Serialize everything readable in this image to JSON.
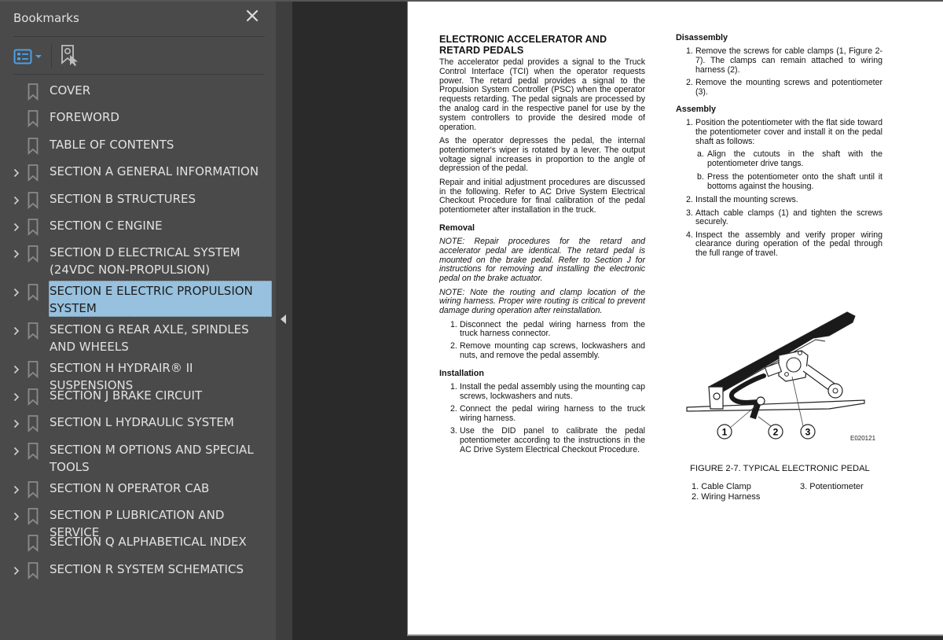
{
  "sidebar": {
    "title": "Bookmarks",
    "close_icon": "close-icon",
    "toolbar": {
      "view_options_icon": "list-view-icon",
      "find_bookmark_icon": "find-current-bookmark-icon"
    },
    "items": [
      {
        "label": "COVER",
        "expandable": false,
        "selected": false
      },
      {
        "label": "FOREWORD",
        "expandable": false,
        "selected": false
      },
      {
        "label": "TABLE OF CONTENTS",
        "expandable": false,
        "selected": false
      },
      {
        "label": "SECTION A GENERAL INFORMATION",
        "expandable": true,
        "selected": false
      },
      {
        "label": "SECTION B STRUCTURES",
        "expandable": true,
        "selected": false
      },
      {
        "label": "SECTION C ENGINE",
        "expandable": true,
        "selected": false
      },
      {
        "label": "SECTION D ELECTRICAL SYSTEM (24VDC NON-PROPULSION)",
        "expandable": true,
        "selected": false
      },
      {
        "label": "SECTION E ELECTRIC PROPULSION SYSTEM",
        "expandable": true,
        "selected": true
      },
      {
        "label": "SECTION G REAR AXLE, SPINDLES AND WHEELS",
        "expandable": true,
        "selected": false
      },
      {
        "label": "SECTION H HYDRAIR® II SUSPENSIONS",
        "expandable": true,
        "selected": false
      },
      {
        "label": "SECTION J BRAKE CIRCUIT",
        "expandable": true,
        "selected": false
      },
      {
        "label": "SECTION L HYDRAULIC SYSTEM",
        "expandable": true,
        "selected": false
      },
      {
        "label": "SECTION M OPTIONS AND SPECIAL TOOLS",
        "expandable": true,
        "selected": false
      },
      {
        "label": "SECTION N OPERATOR CAB",
        "expandable": true,
        "selected": false
      },
      {
        "label": "SECTION P LUBRICATION AND SERVICE",
        "expandable": true,
        "selected": false
      },
      {
        "label": "SECTION Q ALPHABETICAL INDEX",
        "expandable": false,
        "selected": false
      },
      {
        "label": "SECTION R SYSTEM SCHEMATICS",
        "expandable": true,
        "selected": false
      }
    ],
    "colors": {
      "selected_bg": "#97c1de",
      "accent": "#4a9fe8",
      "panel_bg": "#4a4a4a"
    }
  },
  "document": {
    "title": "ELECTRONIC ACCELERATOR AND RETARD PEDALS",
    "intro": [
      "The accelerator pedal provides a signal to the Truck Control Interface (TCI) when the operator requests power. The retard pedal provides a signal to the Propulsion System Controller (PSC) when the operator requests retarding. The pedal signals are processed by the analog card in the respective panel for use by the system controllers to provide the desired mode of operation.",
      "As the operator depresses the pedal, the internal potentiometer's wiper is rotated by a lever. The output voltage signal increases in proportion to the angle of depression of the pedal.",
      "Repair and initial adjustment procedures are discussed in the following. Refer to AC Drive System Electrical Checkout Procedure for final calibration of the pedal potentiometer after installation in the truck."
    ],
    "removal": {
      "heading": "Removal",
      "notes": [
        "NOTE: Repair procedures for the retard and accelerator pedal are identical. The retard pedal is mounted on the brake pedal. Refer to Section J for instructions for removing and installing the electronic pedal on the brake actuator.",
        "NOTE: Note the routing and clamp location of the wiring harness. Proper wire routing is critical to prevent damage during operation after reinstallation."
      ],
      "steps": [
        {
          "num": "1.",
          "text": "Disconnect the pedal wiring harness from the truck harness connector."
        },
        {
          "num": "2.",
          "text": "Remove mounting cap screws, lockwashers and nuts, and remove the pedal assembly."
        }
      ]
    },
    "installation": {
      "heading": "Installation",
      "steps": [
        {
          "num": "1.",
          "text": "Install the pedal assembly using the mounting cap screws, lockwashers and nuts."
        },
        {
          "num": "2.",
          "text": "Connect the pedal wiring harness to the truck wiring harness."
        },
        {
          "num": "3.",
          "text": "Use the DID panel to calibrate the pedal potentiometer according to the instructions in the AC Drive System Electrical Checkout Procedure."
        }
      ]
    },
    "disassembly": {
      "heading": "Disassembly",
      "steps": [
        {
          "num": "1.",
          "text": "Remove the screws for cable clamps (1, Figure 2-7). The clamps can remain attached to wiring harness (2)."
        },
        {
          "num": "2.",
          "text": "Remove the mounting screws and potentiometer (3)."
        }
      ]
    },
    "assembly": {
      "heading": "Assembly",
      "step1": {
        "num": "1.",
        "text": "Position the potentiometer with the flat side toward the potentiometer cover and install it on the pedal shaft as follows:"
      },
      "substeps": [
        {
          "num": "a.",
          "text": "Align the cutouts in the shaft with the potentiometer drive tangs."
        },
        {
          "num": "b.",
          "text": "Press the potentiometer onto the shaft until it bottoms against the housing."
        }
      ],
      "steps": [
        {
          "num": "2.",
          "text": "Install the mounting screws."
        },
        {
          "num": "3.",
          "text": "Attach cable clamps (1) and tighten the screws securely."
        },
        {
          "num": "4.",
          "text": "Inspect the assembly and verify proper wiring clearance during operation of the pedal through the full range of travel."
        }
      ]
    },
    "figure": {
      "id": "E020121",
      "callouts": [
        "1",
        "2",
        "3"
      ],
      "caption": "FIGURE 2-7. TYPICAL ELECTRONIC PEDAL",
      "legend": [
        "1. Cable Clamp",
        "2. Wiring Harness",
        "3. Potentiometer"
      ]
    }
  }
}
